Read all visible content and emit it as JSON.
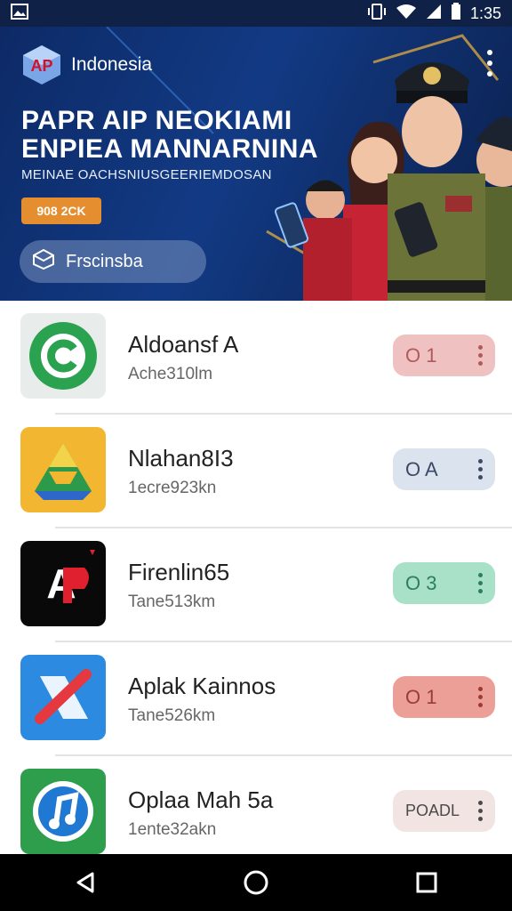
{
  "status_bar": {
    "time": "1:35",
    "icons": [
      "image-icon",
      "vibrate-icon",
      "wifi-icon",
      "signal-icon",
      "battery-icon"
    ]
  },
  "banner": {
    "logo_text": "AP",
    "brand": "Indonesia",
    "headline_line1": "PAPR AIP NEOKIAMI",
    "headline_line2": "ENPIEA MANNARNINA",
    "subline": "MEINAE OACHSNIUSGEERIEMDOSAN",
    "promo": "908 2CK",
    "cta_label": "Frscinsba",
    "cta_icon": "box-icon",
    "menu_icon": "more-vert-icon"
  },
  "apps": [
    {
      "title": "Aldoansf A",
      "subtitle": "Ache310lm",
      "icon": "green-c-icon",
      "action_label": "O 1",
      "action_bg": "#efc1c1",
      "action_fg": "#b05b5b"
    },
    {
      "title": "Nlahan8I3",
      "subtitle": "1ecre923kn",
      "icon": "drive-triangle-icon",
      "action_label": "O A",
      "action_bg": "#dbe3ee",
      "action_fg": "#3b4a66"
    },
    {
      "title": "Firenlin65",
      "subtitle": "Tane513km",
      "icon": "ap-icon",
      "action_label": "O 3",
      "action_bg": "#a9e0c8",
      "action_fg": "#2c7f5c"
    },
    {
      "title": "Aplak Kainnos",
      "subtitle": "Tane526km",
      "icon": "blue-x-icon",
      "action_label": "O 1",
      "action_bg": "#ec9f97",
      "action_fg": "#9c3b33"
    },
    {
      "title": "Oplaa Mah 5a",
      "subtitle": "1ente32akn",
      "icon": "music-note-icon",
      "action_label": "POADL",
      "action_bg": "#f1e4e2",
      "action_fg": "#4a4a4a"
    }
  ],
  "nav": {
    "back_icon": "back-triangle-icon",
    "home_icon": "home-circle-icon",
    "recents_icon": "recents-square-icon"
  }
}
